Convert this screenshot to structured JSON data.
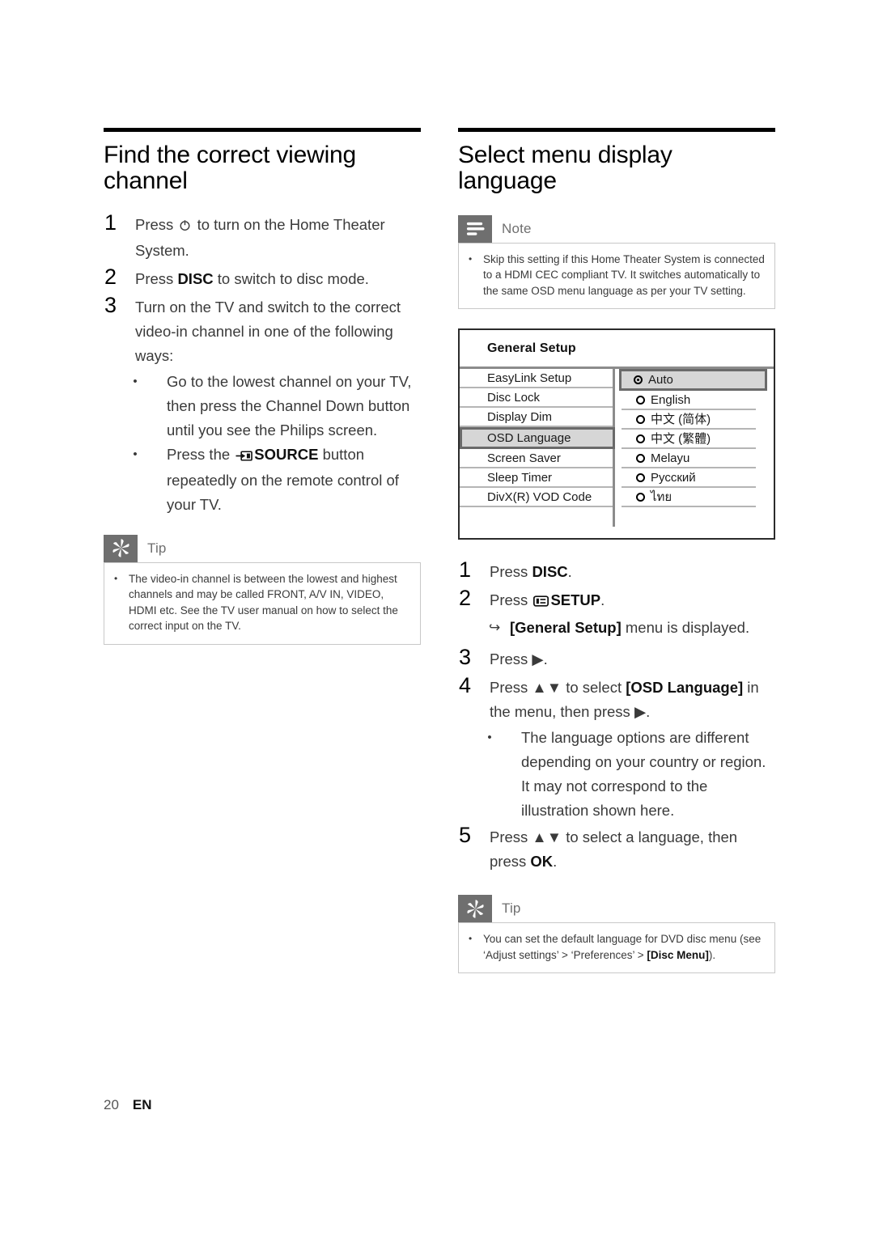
{
  "page": {
    "number": "20",
    "language_code": "EN"
  },
  "left_column": {
    "title": "Find the correct viewing channel",
    "steps": [
      {
        "num": "1",
        "pre": "Press ",
        "icon": "power-icon",
        "post": " to turn on the Home Theater System."
      },
      {
        "num": "2",
        "pre": "Press ",
        "bold": "DISC",
        "post": " to switch to disc mode."
      },
      {
        "num": "3",
        "pre": "Turn on the TV and switch to the correct video-in channel in one of the following ways:"
      }
    ],
    "sub_bullets": [
      {
        "bullet": "•",
        "text": "Go to the lowest channel on your TV, then press the Channel Down button until you see the Philips screen."
      },
      {
        "bullet": "•",
        "pre": "Press the ",
        "icon": "source-icon",
        "bold": "SOURCE",
        "post": " button repeatedly on the remote control of your TV."
      }
    ],
    "tip": {
      "icon": "tip-icon",
      "label": "Tip",
      "items": [
        {
          "bullet": "•",
          "text": "The video-in channel is between the lowest and highest channels and may be called FRONT, A/V IN, VIDEO, HDMI etc. See the TV user manual on how to select the correct input on the TV."
        }
      ]
    }
  },
  "right_column": {
    "title": "Select menu display language",
    "note": {
      "icon": "note-icon",
      "label": "Note",
      "items": [
        {
          "bullet": "•",
          "text": "Skip this setting if this Home Theater System is connected to a HDMI CEC compliant TV. It switches automatically to the same OSD menu language as per your TV setting."
        }
      ]
    },
    "menu_figure": {
      "title": "General Setup",
      "left_items": [
        {
          "label": "EasyLink Setup",
          "selected": false
        },
        {
          "label": "Disc Lock",
          "selected": false
        },
        {
          "label": "Display Dim",
          "selected": false
        },
        {
          "label": "OSD Language",
          "selected": true
        },
        {
          "label": "Screen Saver",
          "selected": false
        },
        {
          "label": "Sleep Timer",
          "selected": false
        },
        {
          "label": "DivX(R) VOD Code",
          "selected": false
        }
      ],
      "right_items": [
        {
          "label": "Auto",
          "checked": true,
          "selected": true
        },
        {
          "label": "English",
          "checked": false,
          "selected": false
        },
        {
          "label": "中文 (简体)",
          "checked": false,
          "selected": false
        },
        {
          "label": "中文 (繁體)",
          "checked": false,
          "selected": false
        },
        {
          "label": "Melayu",
          "checked": false,
          "selected": false
        },
        {
          "label": "Русский",
          "checked": false,
          "selected": false
        },
        {
          "label": "ไทย",
          "checked": false,
          "selected": false
        }
      ]
    },
    "steps": [
      {
        "num": "1",
        "pre": "Press ",
        "bold": "DISC",
        "post": "."
      },
      {
        "num": "2",
        "pre": "Press ",
        "icon": "setup-icon",
        "bold": "SETUP",
        "post": ".",
        "result": {
          "arrow": "↪",
          "bold": "[General Setup]",
          "post": " menu is displayed."
        }
      },
      {
        "num": "3",
        "pre": "Press ▶."
      },
      {
        "num": "4",
        "pre": "Press ▲▼ to select ",
        "bold": "[OSD Language]",
        "post": " in the menu, then press ▶."
      }
    ],
    "step4_bullets": [
      {
        "bullet": "•",
        "text": "The language options are different depending on your country or region. It may not correspond to the illustration shown here."
      }
    ],
    "step5": {
      "num": "5",
      "pre": "Press ▲▼ to select a language, then press ",
      "bold": "OK",
      "post": "."
    },
    "tip": {
      "icon": "tip-icon",
      "label": "Tip",
      "items": [
        {
          "bullet": "•",
          "pre": "You can set the default language for DVD disc menu (see ‘Adjust settings’ > ‘Preferences’ > ",
          "bold": "[Disc Menu]",
          "post": ")."
        }
      ]
    }
  },
  "colors": {
    "badge_gray": "#6f6f6f",
    "box_border": "#c8c8c8",
    "menu_border": "#2b2b2b",
    "menu_selected_bg": "#d6d6d6",
    "menu_divider": "#b5b5b5",
    "rule_black": "#000000"
  }
}
